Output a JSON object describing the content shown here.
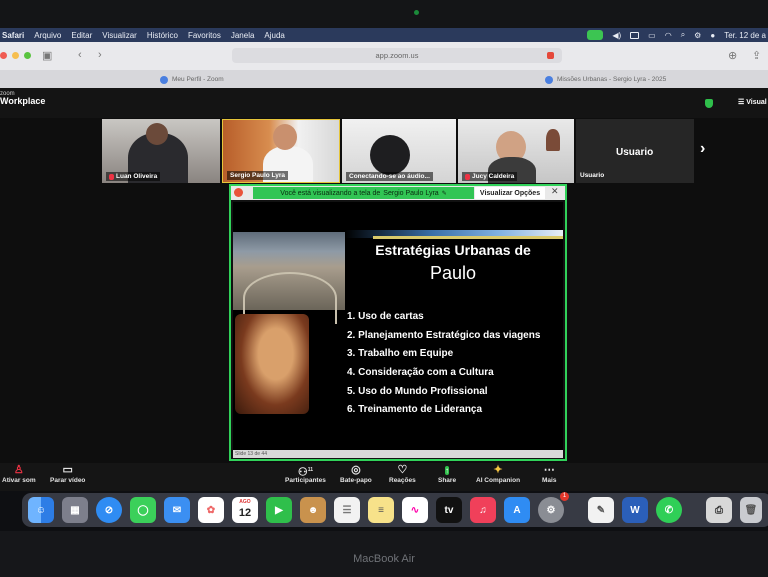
{
  "menubar": {
    "items": [
      "Safari",
      "Arquivo",
      "Editar",
      "Visualizar",
      "Histórico",
      "Favoritos",
      "Janela",
      "Ajuda"
    ],
    "clock": "Ter. 12 de a"
  },
  "browser": {
    "url": "app.zoom.us",
    "tabs": [
      "Meu Perfil - Zoom",
      "Missões Urbanas - Sergio Lyra - 2025"
    ]
  },
  "zoom": {
    "brand_small": "zoom",
    "brand": "Workplace",
    "view_button": "Visual",
    "participants": [
      {
        "name": "Luan Oliveira"
      },
      {
        "name": "Sergio Paulo Lyra"
      },
      {
        "name": "Conectando-se ao áudio..."
      },
      {
        "name": "Jucy Caldeira"
      },
      {
        "name": "Usuario",
        "label": "Usuario"
      }
    ],
    "share_banner": {
      "text": "Você está visualizando a tela de",
      "presenter": "Sergio Paulo Lyra",
      "options": "Visualizar Opções"
    },
    "slide": {
      "title_line1": "Estratégias Urbanas de",
      "title_line2": "Paulo",
      "items": [
        "1. Uso de cartas",
        "2. Planejamento Estratégico das viagens",
        "3. Trabalho em Equipe",
        "4. Consideração com a Cultura",
        "5. Uso do Mundo Profissional",
        "6. Treinamento de Liderança"
      ],
      "footer": "Slide 13 de 44"
    },
    "toolbar": {
      "mic": "Ativar som",
      "video": "Parar vídeo",
      "participants": "Participantes",
      "participants_count": "11",
      "chat": "Bate-papo",
      "reactions": "Reações",
      "share": "Share",
      "companion": "AI Companion",
      "more": "Mais"
    }
  },
  "dock": {
    "calendar_month": "AGO",
    "calendar_day": "12",
    "settings_badge": "1"
  },
  "laptop_label": "MacBook Air"
}
